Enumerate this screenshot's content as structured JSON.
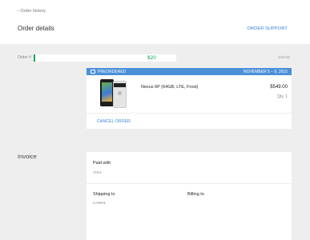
{
  "header": {
    "back_label": "‹ Order history",
    "title": "Order details",
    "support_label": "ORDER SUPPORT"
  },
  "order": {
    "label": "Order #",
    "amount": "$20",
    "date": "10/1/15"
  },
  "shipment": {
    "status": "PREORDERED",
    "date_range": "NOVEMBER 5 – 9, 2015",
    "product_name": "Nexus 6P (64GB, LTE, Frost)",
    "price": "$549.00",
    "quantity": "Qty. 1",
    "cancel_label": "CANCEL ORDER",
    "product_image_icon": "nexus-6p-phone-image"
  },
  "invoice": {
    "heading": "Invoice",
    "paid_with_label": "Paid with",
    "paid_with_value": "VISA",
    "shipping_to_label": "Shipping to",
    "shipping_to_value": "CAROL",
    "billing_to_label": "Billing to"
  },
  "colors": {
    "accent": "#2e7dd7",
    "banner": "#4a90d9",
    "amount_green": "#16a35a",
    "background": "#eeeeee"
  }
}
